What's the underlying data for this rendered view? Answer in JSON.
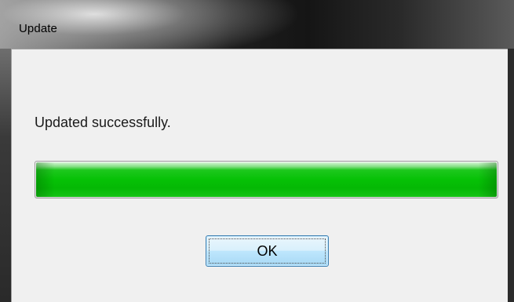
{
  "window": {
    "title": "Update"
  },
  "dialog": {
    "message": "Updated successfully.",
    "progress_percent": 100,
    "ok_label": "OK"
  },
  "colors": {
    "progress_fill": "#06c106",
    "button_border": "#3c7fb1",
    "client_background": "#f0f0f0"
  }
}
